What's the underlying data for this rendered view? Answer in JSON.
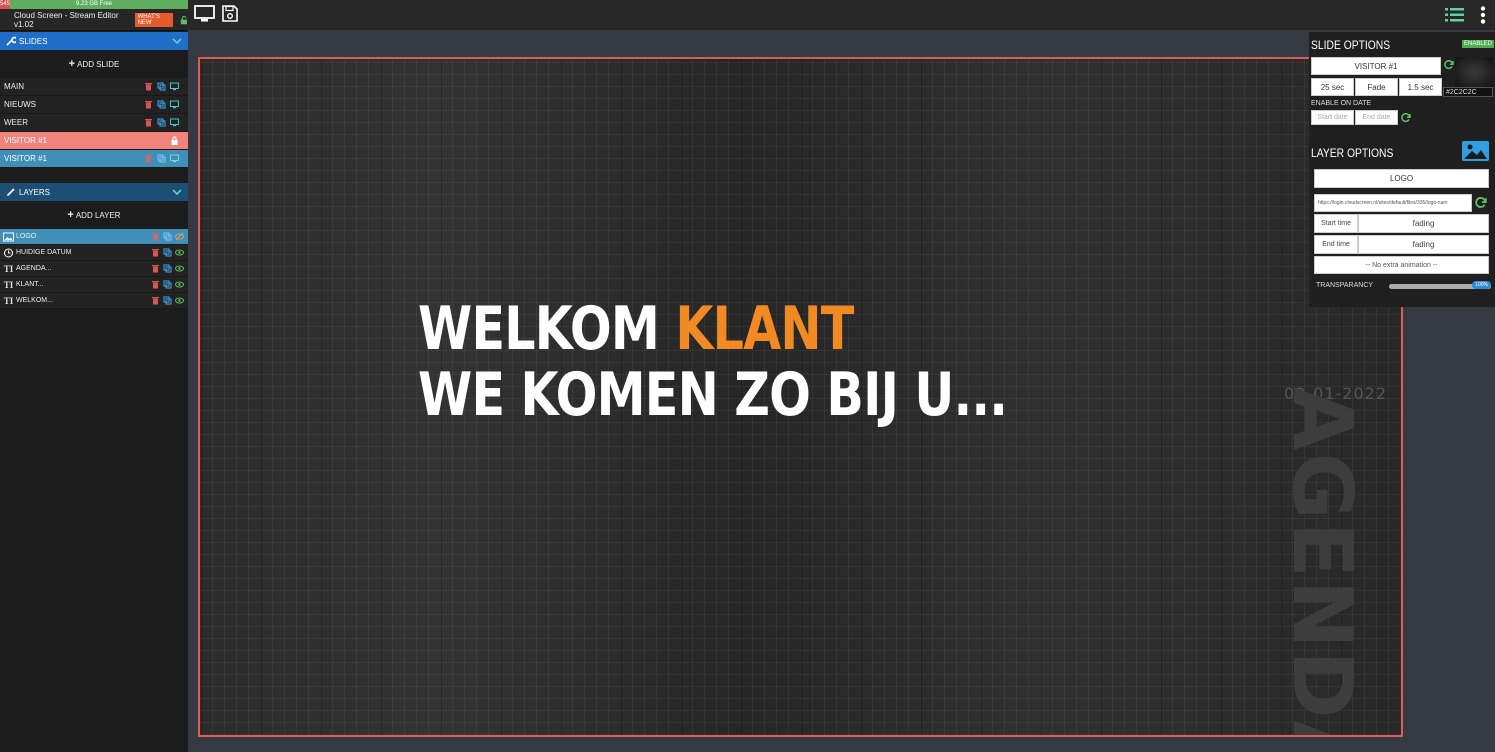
{
  "storage": {
    "used_label": "545",
    "free_label": "9.23 GB Free",
    "free_fraction": 1.0
  },
  "app": {
    "title": "Cloud Screen - Stream Editor v1.02",
    "whats_new": "WHAT'S NEW"
  },
  "slides_section": {
    "title": "SLIDES",
    "add_label": "ADD SLIDE",
    "items": [
      {
        "label": "MAIN"
      },
      {
        "label": "NIEUWS"
      },
      {
        "label": "WEER"
      },
      {
        "label": "VISITOR #1"
      },
      {
        "label": "VISITOR #1"
      }
    ]
  },
  "layers_section": {
    "title": "LAYERS",
    "add_label": "ADD LAYER",
    "items": [
      {
        "label": "LOGO",
        "icon": "image-icon"
      },
      {
        "label": "HUIDIGE DATUM",
        "icon": "clock-icon"
      },
      {
        "label": "AGENDA...",
        "icon": "text-icon"
      },
      {
        "label": "KLANT...",
        "icon": "text-icon"
      },
      {
        "label": "WELKOM...",
        "icon": "text-icon"
      }
    ]
  },
  "text_icon_glyph": "TI",
  "canvas": {
    "line1_a": "WELKOM ",
    "line1_b": "KLANT",
    "line2": "WE KOMEN ZO BIJ U...",
    "date": "02-01-2022",
    "vertical": "AGENDA",
    "accent_color": "#f28a23"
  },
  "slide_options": {
    "title": "SLIDE OPTIONS",
    "status": "ENABLED",
    "name": "VISITOR #1",
    "duration": "25 sec",
    "transition": "Fade",
    "transition_time": "1.5 sec",
    "bg_color": "#2C2C2C",
    "enable_on_date_label": "ENABLE ON DATE",
    "start_placeholder": "Start date",
    "end_placeholder": "End date"
  },
  "layer_options": {
    "title": "LAYER OPTIONS",
    "name": "LOGO",
    "url": "https://login.cloudscreen.nl/sites/default/files/335/logo-nam",
    "start_time_label": "Start time",
    "start_time_value": "fading",
    "end_time_label": "End time",
    "end_time_value": "fading",
    "animation": "-- No extra animation --",
    "transparency_label": "TRANSPARANCY",
    "transparency_value": "100%",
    "transparency_fraction": 1.0
  }
}
